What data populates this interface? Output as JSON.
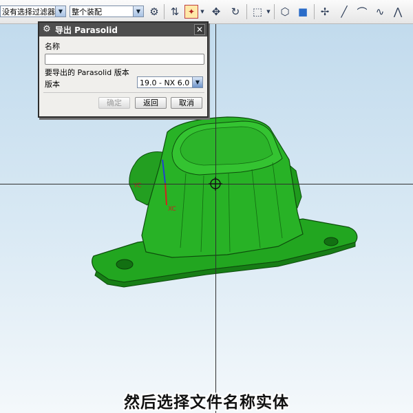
{
  "toolbar": {
    "filter_combo": "没有选择过滤器",
    "assembly_combo": "整个装配",
    "icons": [
      "snap-icon",
      "select-icon",
      "sequence-icon",
      "align-icon",
      "rectangle-select-icon",
      "shade-icon",
      "solid-cube-icon",
      "move-icon",
      "line-icon",
      "arc-icon",
      "spline-icon"
    ]
  },
  "dialog": {
    "title": "导出 Parasolid",
    "name_label": "名称",
    "name_value": "",
    "version_section": "要导出的 Parasolid 版本",
    "version_label": "版本",
    "version_value": "19.0 - NX 6.0",
    "ok_label": "确定",
    "back_label": "返回",
    "cancel_label": "取消"
  },
  "viewport": {
    "axis_labels": {
      "yc": "YC",
      "xc": "XC"
    },
    "model_color": "#21a61f",
    "background_top": "#bfd9ec"
  },
  "subtitle": "然后选择文件名称实体"
}
